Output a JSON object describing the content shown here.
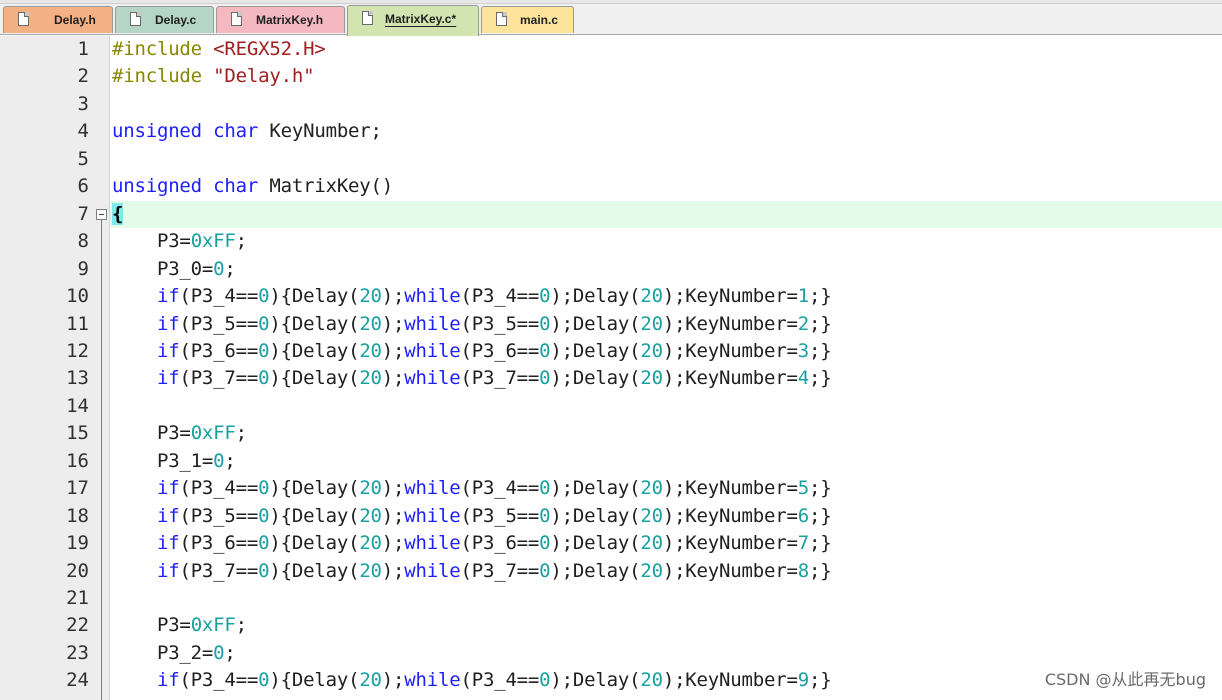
{
  "tabs": [
    {
      "label": "Delay.h",
      "color": "#f4b183",
      "active": false
    },
    {
      "label": "Delay.c",
      "color": "#b4d5c8",
      "active": false
    },
    {
      "label": "MatrixKey.h",
      "color": "#f4b8c0",
      "active": false
    },
    {
      "label": "MatrixKey.c*",
      "color": "#d2e5b0",
      "active": true
    },
    {
      "label": "main.c",
      "color": "#fde49a",
      "active": false
    }
  ],
  "editor": {
    "current_line": 7,
    "lines": [
      {
        "n": "1",
        "segs": [
          [
            "pp",
            "#include "
          ],
          [
            "str",
            "<REGX52.H>"
          ]
        ]
      },
      {
        "n": "2",
        "segs": [
          [
            "pp",
            "#include "
          ],
          [
            "str",
            "\"Delay.h\""
          ]
        ]
      },
      {
        "n": "3",
        "segs": []
      },
      {
        "n": "4",
        "segs": [
          [
            "kw",
            "unsigned"
          ],
          [
            "t",
            " "
          ],
          [
            "kw",
            "char"
          ],
          [
            "t",
            " KeyNumber;"
          ]
        ]
      },
      {
        "n": "5",
        "segs": []
      },
      {
        "n": "6",
        "segs": [
          [
            "kw",
            "unsigned"
          ],
          [
            "t",
            " "
          ],
          [
            "kw",
            "char"
          ],
          [
            "t",
            " MatrixKey()"
          ]
        ]
      },
      {
        "n": "7",
        "segs": [
          [
            "brace",
            "{"
          ]
        ]
      },
      {
        "n": "8",
        "segs": [
          [
            "t",
            "    P3="
          ],
          [
            "num",
            "0xFF"
          ],
          [
            "t",
            ";"
          ]
        ]
      },
      {
        "n": "9",
        "segs": [
          [
            "t",
            "    P3_0="
          ],
          [
            "num",
            "0"
          ],
          [
            "t",
            ";"
          ]
        ]
      },
      {
        "n": "10",
        "segs": [
          [
            "t",
            "    "
          ],
          [
            "kw",
            "if"
          ],
          [
            "t",
            "(P3_4=="
          ],
          [
            "num",
            "0"
          ],
          [
            "t",
            "){Delay("
          ],
          [
            "num",
            "20"
          ],
          [
            "t",
            ");"
          ],
          [
            "kw",
            "while"
          ],
          [
            "t",
            "(P3_4=="
          ],
          [
            "num",
            "0"
          ],
          [
            "t",
            ");Delay("
          ],
          [
            "num",
            "20"
          ],
          [
            "t",
            ");KeyNumber="
          ],
          [
            "num",
            "1"
          ],
          [
            "t",
            ";}"
          ]
        ]
      },
      {
        "n": "11",
        "segs": [
          [
            "t",
            "    "
          ],
          [
            "kw",
            "if"
          ],
          [
            "t",
            "(P3_5=="
          ],
          [
            "num",
            "0"
          ],
          [
            "t",
            "){Delay("
          ],
          [
            "num",
            "20"
          ],
          [
            "t",
            ");"
          ],
          [
            "kw",
            "while"
          ],
          [
            "t",
            "(P3_5=="
          ],
          [
            "num",
            "0"
          ],
          [
            "t",
            ");Delay("
          ],
          [
            "num",
            "20"
          ],
          [
            "t",
            ");KeyNumber="
          ],
          [
            "num",
            "2"
          ],
          [
            "t",
            ";}"
          ]
        ]
      },
      {
        "n": "12",
        "segs": [
          [
            "t",
            "    "
          ],
          [
            "kw",
            "if"
          ],
          [
            "t",
            "(P3_6=="
          ],
          [
            "num",
            "0"
          ],
          [
            "t",
            "){Delay("
          ],
          [
            "num",
            "20"
          ],
          [
            "t",
            ");"
          ],
          [
            "kw",
            "while"
          ],
          [
            "t",
            "(P3_6=="
          ],
          [
            "num",
            "0"
          ],
          [
            "t",
            ");Delay("
          ],
          [
            "num",
            "20"
          ],
          [
            "t",
            ");KeyNumber="
          ],
          [
            "num",
            "3"
          ],
          [
            "t",
            ";}"
          ]
        ]
      },
      {
        "n": "13",
        "segs": [
          [
            "t",
            "    "
          ],
          [
            "kw",
            "if"
          ],
          [
            "t",
            "(P3_7=="
          ],
          [
            "num",
            "0"
          ],
          [
            "t",
            "){Delay("
          ],
          [
            "num",
            "20"
          ],
          [
            "t",
            ");"
          ],
          [
            "kw",
            "while"
          ],
          [
            "t",
            "(P3_7=="
          ],
          [
            "num",
            "0"
          ],
          [
            "t",
            ");Delay("
          ],
          [
            "num",
            "20"
          ],
          [
            "t",
            ");KeyNumber="
          ],
          [
            "num",
            "4"
          ],
          [
            "t",
            ";}"
          ]
        ]
      },
      {
        "n": "14",
        "segs": []
      },
      {
        "n": "15",
        "segs": [
          [
            "t",
            "    P3="
          ],
          [
            "num",
            "0xFF"
          ],
          [
            "t",
            ";"
          ]
        ]
      },
      {
        "n": "16",
        "segs": [
          [
            "t",
            "    P3_1="
          ],
          [
            "num",
            "0"
          ],
          [
            "t",
            ";"
          ]
        ]
      },
      {
        "n": "17",
        "segs": [
          [
            "t",
            "    "
          ],
          [
            "kw",
            "if"
          ],
          [
            "t",
            "(P3_4=="
          ],
          [
            "num",
            "0"
          ],
          [
            "t",
            "){Delay("
          ],
          [
            "num",
            "20"
          ],
          [
            "t",
            ");"
          ],
          [
            "kw",
            "while"
          ],
          [
            "t",
            "(P3_4=="
          ],
          [
            "num",
            "0"
          ],
          [
            "t",
            ");Delay("
          ],
          [
            "num",
            "20"
          ],
          [
            "t",
            ");KeyNumber="
          ],
          [
            "num",
            "5"
          ],
          [
            "t",
            ";}"
          ]
        ]
      },
      {
        "n": "18",
        "segs": [
          [
            "t",
            "    "
          ],
          [
            "kw",
            "if"
          ],
          [
            "t",
            "(P3_5=="
          ],
          [
            "num",
            "0"
          ],
          [
            "t",
            "){Delay("
          ],
          [
            "num",
            "20"
          ],
          [
            "t",
            ");"
          ],
          [
            "kw",
            "while"
          ],
          [
            "t",
            "(P3_5=="
          ],
          [
            "num",
            "0"
          ],
          [
            "t",
            ");Delay("
          ],
          [
            "num",
            "20"
          ],
          [
            "t",
            ");KeyNumber="
          ],
          [
            "num",
            "6"
          ],
          [
            "t",
            ";}"
          ]
        ]
      },
      {
        "n": "19",
        "segs": [
          [
            "t",
            "    "
          ],
          [
            "kw",
            "if"
          ],
          [
            "t",
            "(P3_6=="
          ],
          [
            "num",
            "0"
          ],
          [
            "t",
            "){Delay("
          ],
          [
            "num",
            "20"
          ],
          [
            "t",
            ");"
          ],
          [
            "kw",
            "while"
          ],
          [
            "t",
            "(P3_6=="
          ],
          [
            "num",
            "0"
          ],
          [
            "t",
            ");Delay("
          ],
          [
            "num",
            "20"
          ],
          [
            "t",
            ");KeyNumber="
          ],
          [
            "num",
            "7"
          ],
          [
            "t",
            ";}"
          ]
        ]
      },
      {
        "n": "20",
        "segs": [
          [
            "t",
            "    "
          ],
          [
            "kw",
            "if"
          ],
          [
            "t",
            "(P3_7=="
          ],
          [
            "num",
            "0"
          ],
          [
            "t",
            "){Delay("
          ],
          [
            "num",
            "20"
          ],
          [
            "t",
            ");"
          ],
          [
            "kw",
            "while"
          ],
          [
            "t",
            "(P3_7=="
          ],
          [
            "num",
            "0"
          ],
          [
            "t",
            ");Delay("
          ],
          [
            "num",
            "20"
          ],
          [
            "t",
            ");KeyNumber="
          ],
          [
            "num",
            "8"
          ],
          [
            "t",
            ";}"
          ]
        ]
      },
      {
        "n": "21",
        "segs": []
      },
      {
        "n": "22",
        "segs": [
          [
            "t",
            "    P3="
          ],
          [
            "num",
            "0xFF"
          ],
          [
            "t",
            ";"
          ]
        ]
      },
      {
        "n": "23",
        "segs": [
          [
            "t",
            "    P3_2="
          ],
          [
            "num",
            "0"
          ],
          [
            "t",
            ";"
          ]
        ]
      },
      {
        "n": "24",
        "segs": [
          [
            "t",
            "    "
          ],
          [
            "kw",
            "if"
          ],
          [
            "t",
            "(P3_4=="
          ],
          [
            "num",
            "0"
          ],
          [
            "t",
            "){Delay("
          ],
          [
            "num",
            "20"
          ],
          [
            "t",
            ");"
          ],
          [
            "kw",
            "while"
          ],
          [
            "t",
            "(P3_4=="
          ],
          [
            "num",
            "0"
          ],
          [
            "t",
            ");Delay("
          ],
          [
            "num",
            "20"
          ],
          [
            "t",
            ");KeyNumber="
          ],
          [
            "num",
            "9"
          ],
          [
            "t",
            ";}"
          ]
        ]
      }
    ]
  },
  "watermark": "CSDN @从此再无bug"
}
